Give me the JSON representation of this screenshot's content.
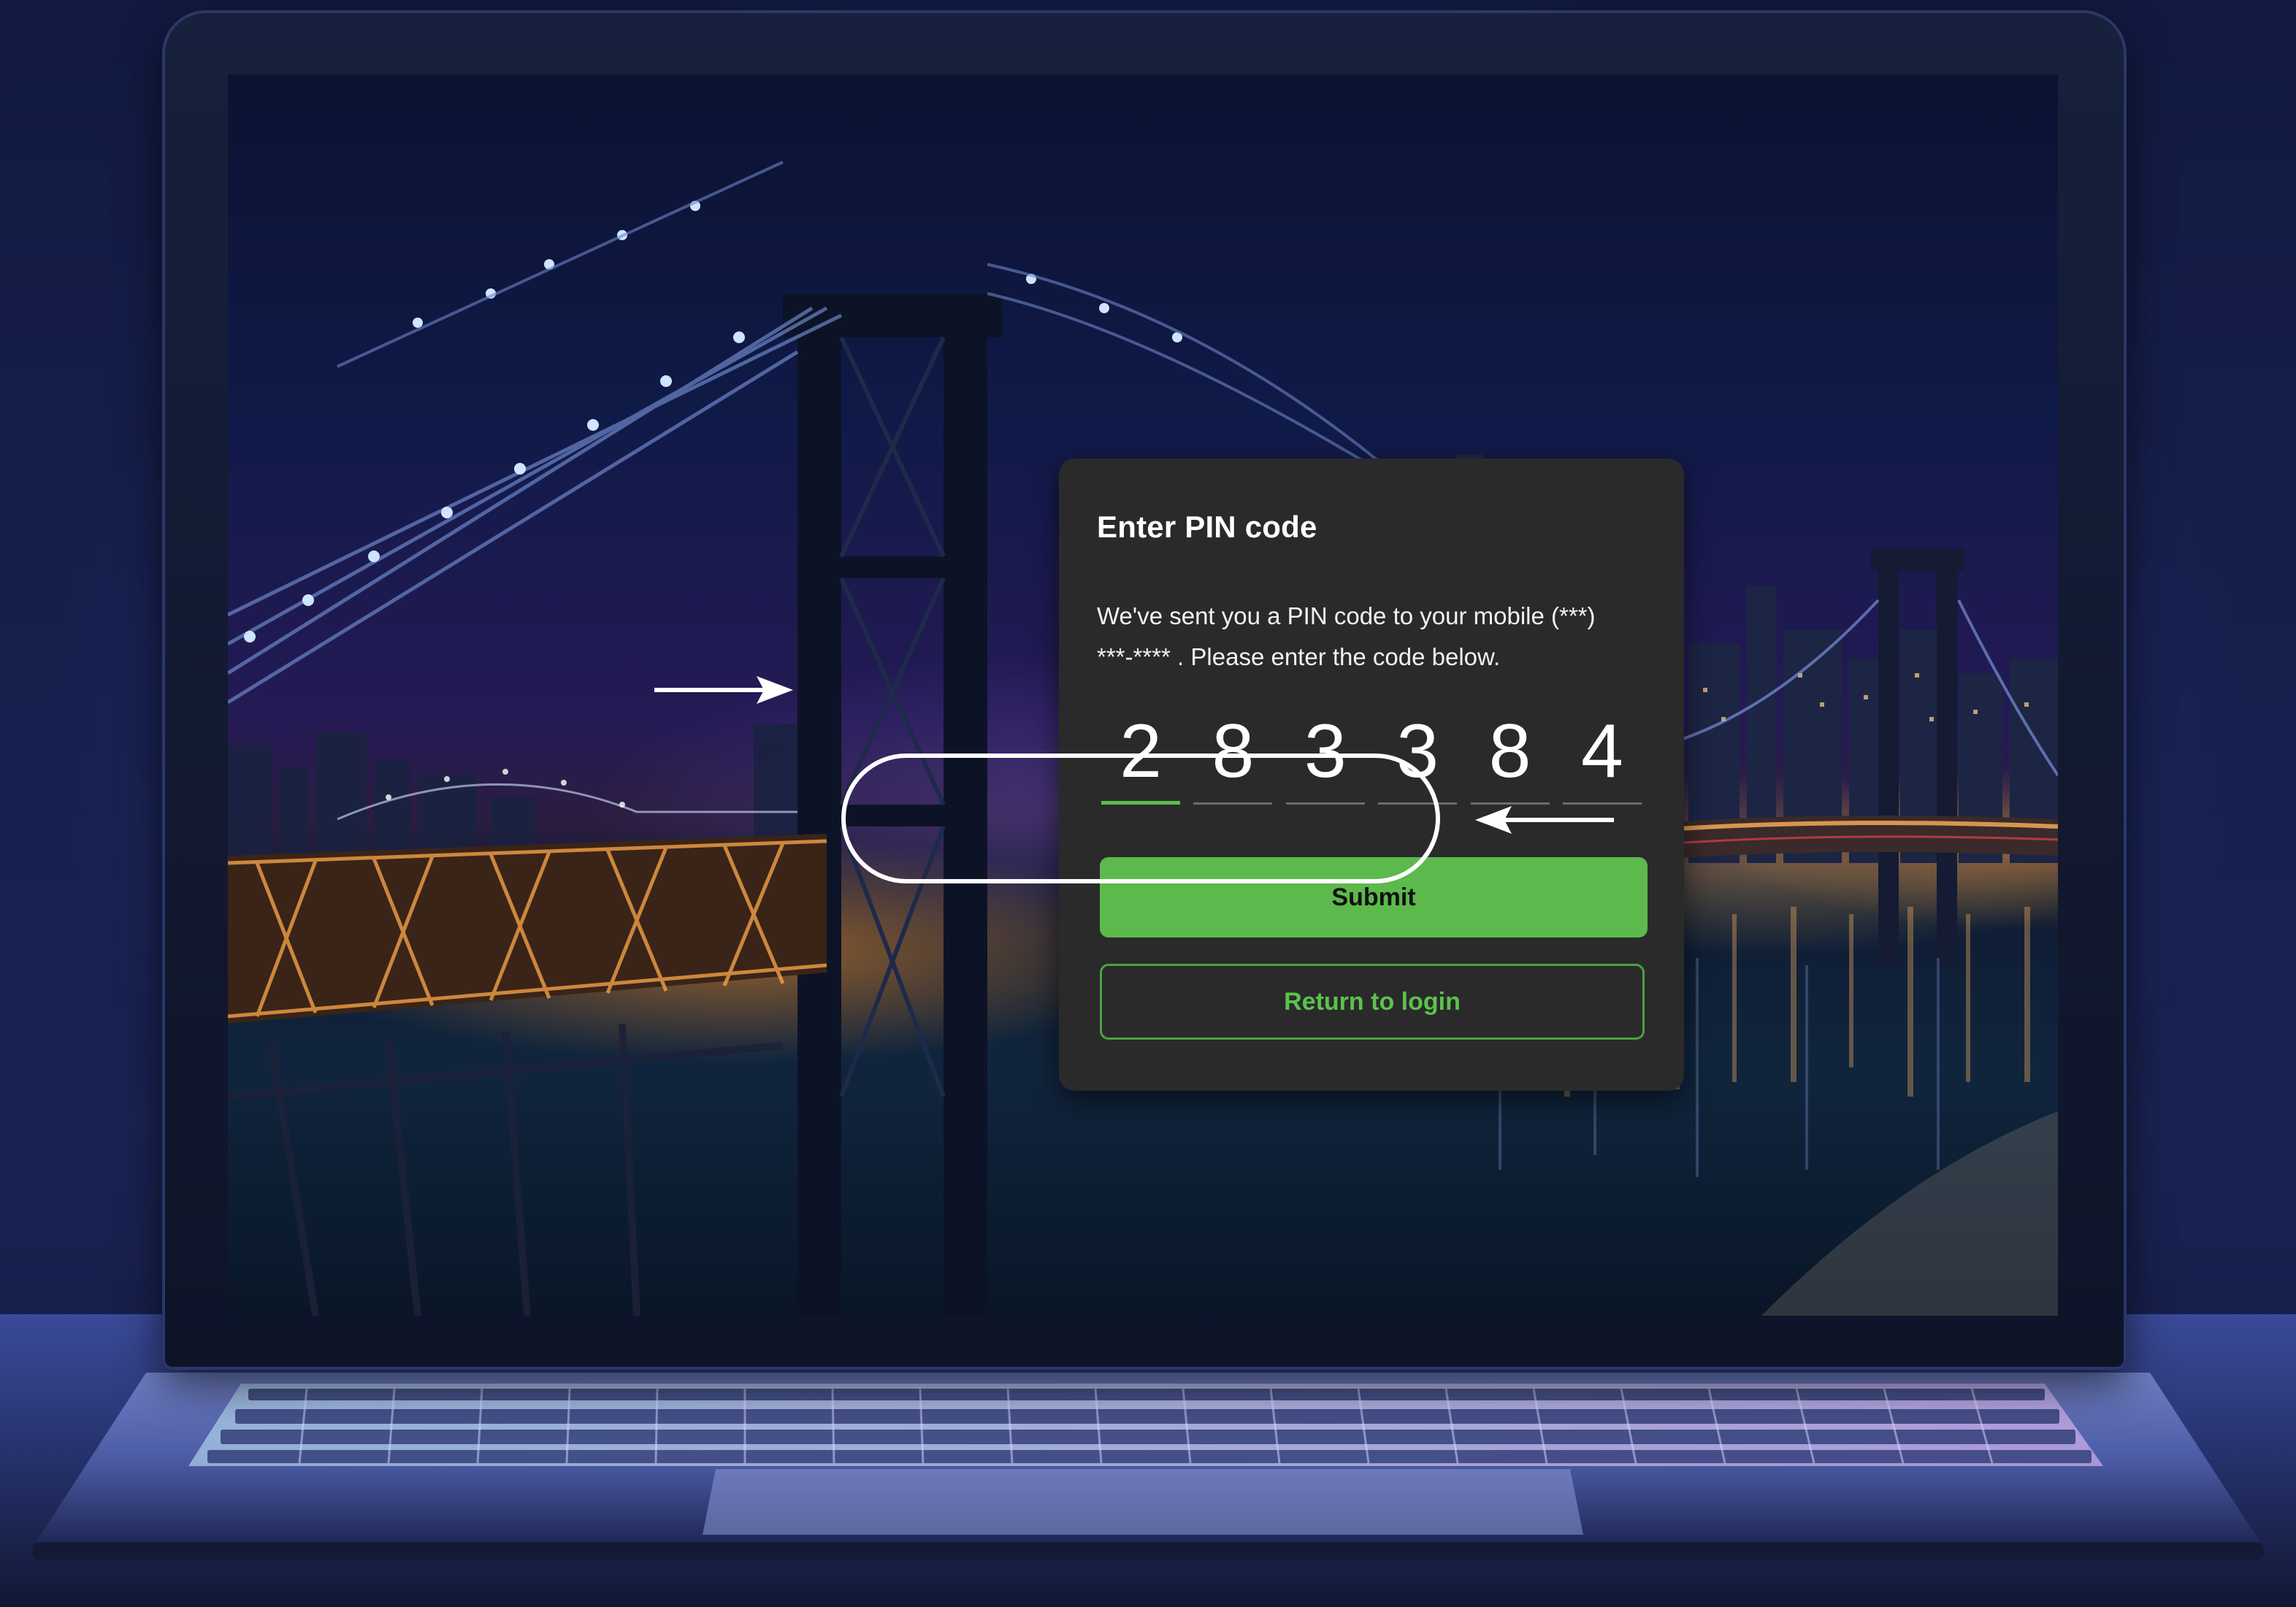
{
  "dialog": {
    "title": "Enter PIN code",
    "message_line1": "We've sent you a PIN code to your mobile (***)",
    "message_line2": "***-**** . Please enter the code below.",
    "pin_digits": [
      "2",
      "8",
      "3",
      "3",
      "8",
      "4"
    ],
    "submit_label": "Submit",
    "return_label": "Return to login"
  },
  "colors": {
    "dialog_bg": "#2a2a2b",
    "accent_green": "#5cb94c",
    "text_white": "#ffffff"
  },
  "icons": {
    "left_annotation": "arrow-right-icon",
    "right_annotation": "arrow-left-icon"
  }
}
